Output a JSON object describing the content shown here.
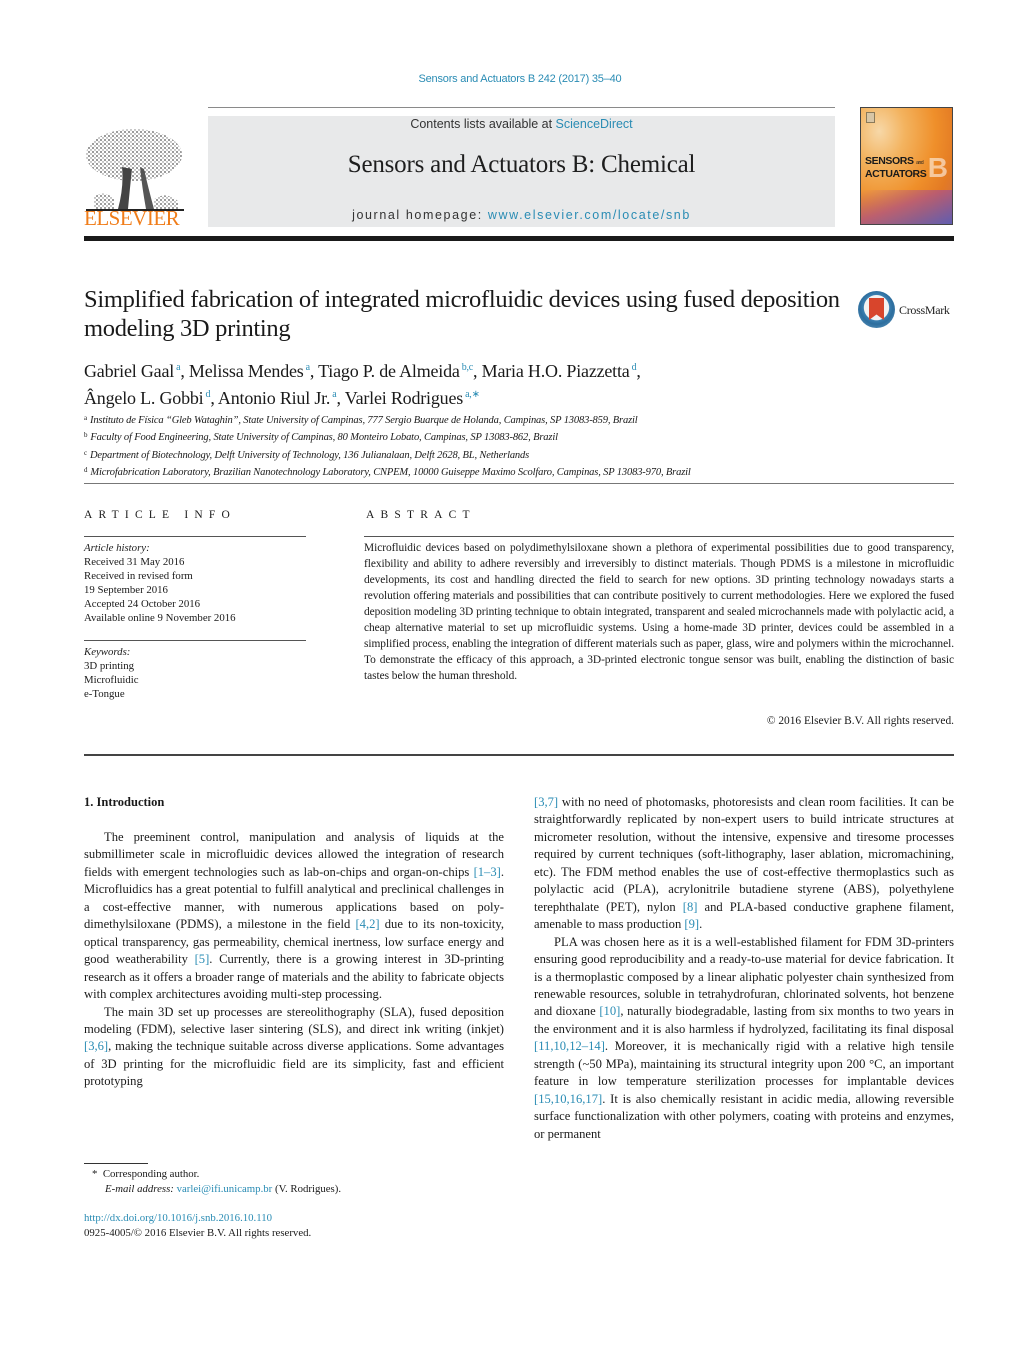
{
  "header": {
    "citation": "Sensors and Actuators B 242 (2017) 35–40",
    "contents_prefix": "Contents lists available at ",
    "contents_link": "ScienceDirect",
    "journal_title": "Sensors and Actuators B: Chemical",
    "homepage_prefix": "journal homepage: ",
    "homepage_link": "www.elsevier.com/locate/snb",
    "publisher_logo_text": "ELSEVIER",
    "cover": {
      "line1": "SENSORS",
      "and": "and",
      "line2": "ACTUATORS",
      "letter": "B"
    }
  },
  "article": {
    "title": "Simplified fabrication of integrated microfluidic devices using fused deposition modeling 3D printing",
    "crossmark_label": "CrossMark",
    "authors": [
      {
        "name": "Gabriel Gaal",
        "aff": "a"
      },
      {
        "name": "Melissa Mendes",
        "aff": "a"
      },
      {
        "name": "Tiago P. de Almeida",
        "aff": "b,c"
      },
      {
        "name": "Maria H.O. Piazzetta",
        "aff": "d"
      },
      {
        "name": "Ângelo L. Gobbi",
        "aff": "d"
      },
      {
        "name": "Antonio Riul Jr.",
        "aff": "a"
      },
      {
        "name": "Varlei Rodrigues",
        "aff": "a,∗"
      }
    ],
    "affiliations": [
      {
        "key": "a",
        "text": "Instituto de Física “Gleb Wataghin”, State University of Campinas, 777 Sergio Buarque de Holanda, Campinas, SP 13083-859, Brazil"
      },
      {
        "key": "b",
        "text": "Faculty of Food Engineering, State University of Campinas, 80 Monteiro Lobato, Campinas, SP 13083-862, Brazil"
      },
      {
        "key": "c",
        "text": "Department of Biotechnology, Delft University of Technology, 136 Julianalaan, Delft 2628, BL, Netherlands"
      },
      {
        "key": "d",
        "text": "Microfabrication Laboratory, Brazilian Nanotechnology Laboratory, CNPEM, 10000 Guiseppe Maximo Scolfaro, Campinas, SP 13083-970, Brazil"
      }
    ]
  },
  "article_info": {
    "heading": "ARTICLE INFO",
    "history_label": "Article history:",
    "history": [
      "Received 31 May 2016",
      "Received in revised form",
      "19 September 2016",
      "Accepted 24 October 2016",
      "Available online 9 November 2016"
    ],
    "keywords_label": "Keywords:",
    "keywords": [
      "3D printing",
      "Microfluidic",
      "e-Tongue"
    ]
  },
  "abstract": {
    "heading": "ABSTRACT",
    "text": "Microfluidic devices based on polydimethylsiloxane shown a plethora of experimental possibilities due to good transparency, flexibility and ability to adhere reversibly and irreversibly to distinct materials. Though PDMS is a milestone in microfluidic developments, its cost and handling directed the field to search for new options. 3D printing technology nowadays starts a revolution offering materials and pos­sibilities that can contribute positively to current methodologies. Here we explored the fused deposition modeling 3D printing technique to obtain integrated, transparent and sealed microchannels made with polylactic acid, a cheap alternative material to set up microfluidic systems. Using a home-made 3D printer, devices could be assembled in a simplified process, enabling the integration of different materials such as paper, glass, wire and polymers within the microchannel. To demonstrate the efficacy of this approach, a 3D-printed electronic tongue sensor was built, enabling the distinction of basic tastes below the human threshold.",
    "copyright": "© 2016 Elsevier B.V. All rights reserved."
  },
  "body": {
    "section_title": "1.  Introduction",
    "left": {
      "p1": [
        {
          "t": "The preeminent control, manipulation and analysis of liquids at the submillimeter scale in microfluidic devices allowed the integration of research fields with emergent technologies such as lab-on-chips and organ-on-chips "
        },
        {
          "ref": "[1–3]"
        },
        {
          "t": ". Microfluidics has a great potential to fulfill analytical and preclinical challenges in a cost-effective manner, with numerous applications based on poly­dimethylsiloxane (PDMS), a milestone in the field "
        },
        {
          "ref": "[4,2]"
        },
        {
          "t": " due to its non-toxicity, optical transparency, gas permeability, chemical inertness, low surface energy and good weatherability "
        },
        {
          "ref": "[5]"
        },
        {
          "t": ". Cur­rently, there is a growing interest in 3D-printing research as it offers a broader range of materials and the ability to fabricate objects with complex architectures avoiding multi-step processing."
        }
      ],
      "p2": [
        {
          "t": "The main 3D set up processes are stereolithography (SLA), fused deposition modeling (FDM), selective laser sintering (SLS), and direct ink writing (inkjet) "
        },
        {
          "ref": "[3,6]"
        },
        {
          "t": ", making the technique suitable across diverse applications. Some advantages of 3D printing for the microfluidic field are its simplicity, fast and efficient prototyping"
        }
      ]
    },
    "right": {
      "p1": [
        {
          "ref": "[3,7]"
        },
        {
          "t": " with no need of photomasks, photoresists and clean room facilities. It can be straightforwardly replicated by non-expert users to build intricate structures at micrometer resolution, without the intensive, expensive and tiresome processes required by current techniques (soft-lithography, laser ablation, micromachining, etc). The FDM method enables the use of cost-effective thermoplastics such as polylactic acid (PLA), acrylonitrile butadiene styrene (ABS), polyethylene terephthalate (PET), nylon "
        },
        {
          "ref": "[8]"
        },
        {
          "t": " and PLA-based conductive graphene filament, amenable to mass production "
        },
        {
          "ref": "[9]"
        },
        {
          "t": "."
        }
      ],
      "p2": [
        {
          "t": "PLA was chosen here as it is a well-established filament for FDM 3D-printers ensuring good reproducibility and a ready-to-use material for device fabrication. It is a thermoplastic composed by a linear aliphatic polyester chain synthesized from renewable resources, soluble in tetrahydrofuran, chlorinated solvents, hot benzene and dioxane "
        },
        {
          "ref": "[10]"
        },
        {
          "t": ", naturally biodegradable, lasting from six months to two years in the environment and it is also harmless if hydrolyzed, facilitating its final disposal "
        },
        {
          "ref": "[11,10,12–14]"
        },
        {
          "t": ". More­over, it is mechanically rigid with a relative high tensile strength (~50 MPa), maintaining its structural integrity upon 200 °C, an important feature in low temperature sterilization processes for implantable devices "
        },
        {
          "ref": "[15,10,16,17]"
        },
        {
          "t": ". It is also chemically resistant in acidic media, allowing reversible surface functionalization with other polymers, coating with proteins and enzymes, or permanent"
        }
      ]
    }
  },
  "footnote": {
    "marker": "*",
    "corresponding": "Corresponding author.",
    "email_label": "E-mail address:",
    "email": "varlei@ifi.unicamp.br",
    "email_owner": "(V. Rodrigues)."
  },
  "doi": {
    "url": "http://dx.doi.org/10.1016/j.snb.2016.10.110",
    "issn_line": "0925-4005/© 2016 Elsevier B.V. All rights reserved."
  }
}
